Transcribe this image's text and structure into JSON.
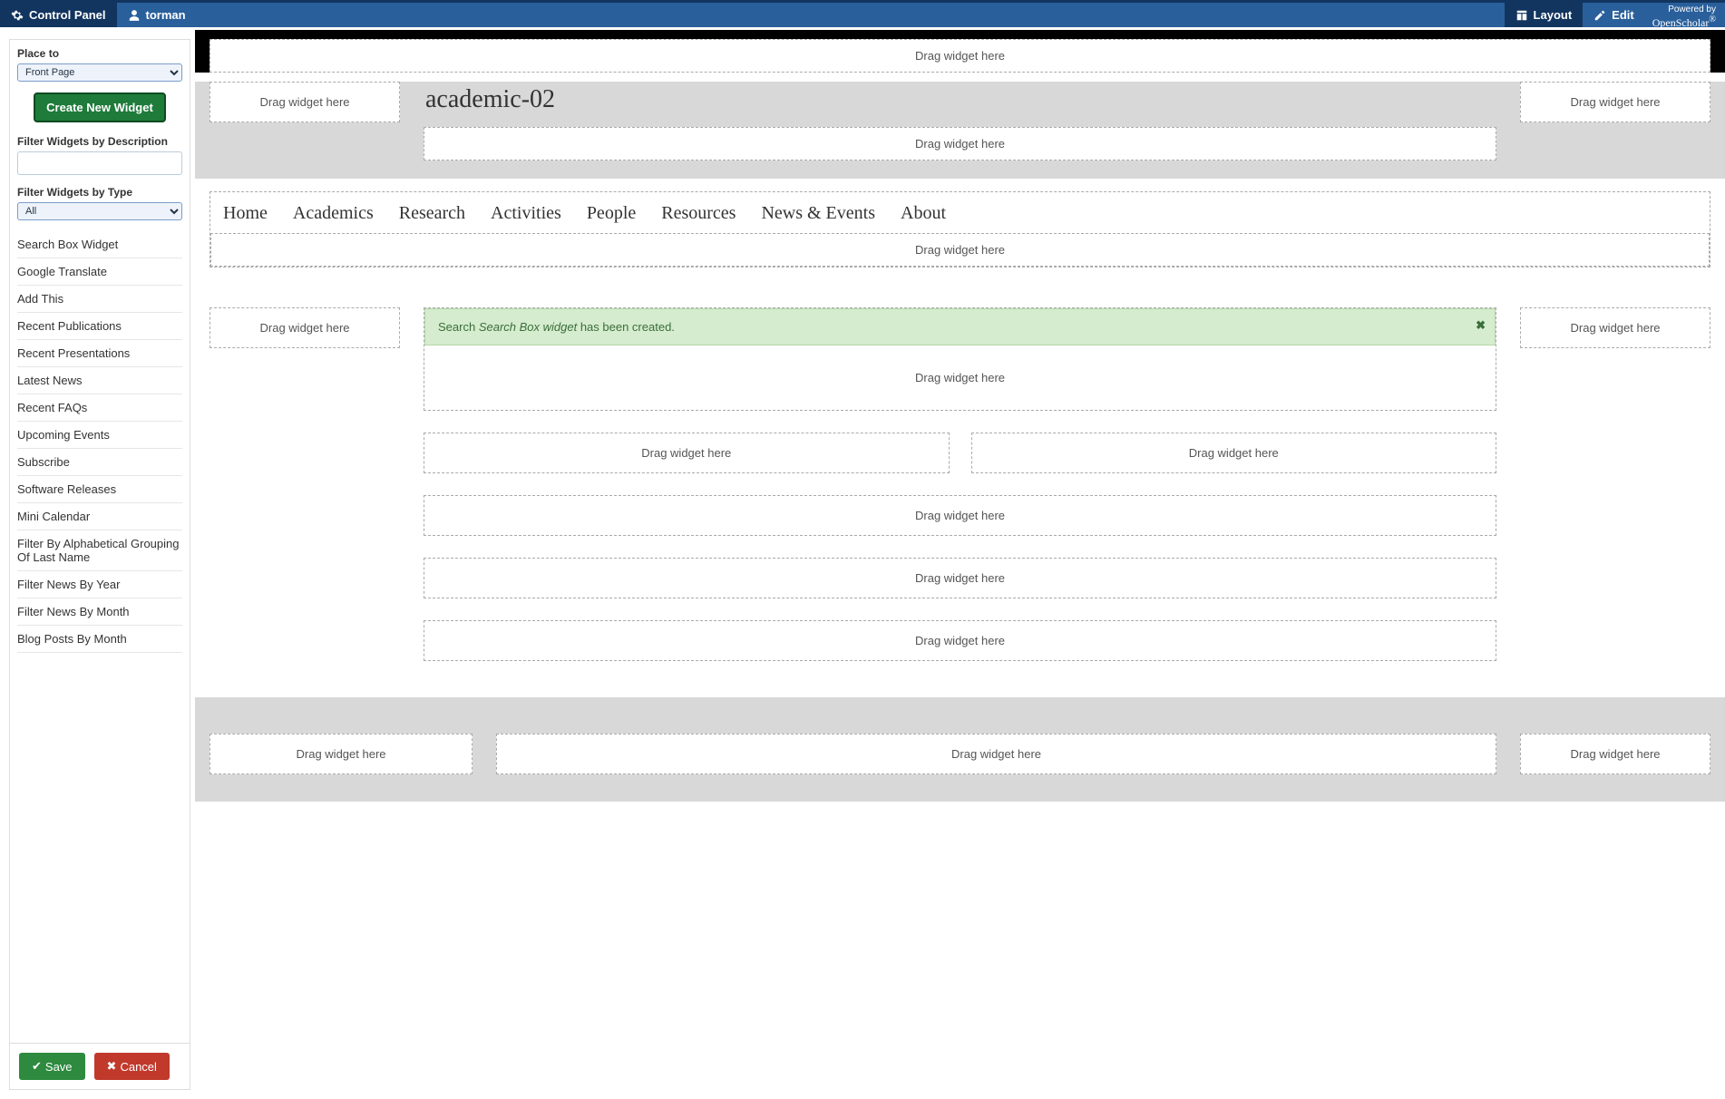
{
  "adminbar": {
    "control_panel": "Control Panel",
    "username": "torman",
    "layout": "Layout",
    "edit": "Edit",
    "powered_by": "Powered by",
    "openscholar": "OpenScholar"
  },
  "sidebar": {
    "place_to_label": "Place to",
    "place_to_value": "Front Page",
    "create_button": "Create New Widget",
    "filter_desc_label": "Filter Widgets by Description",
    "filter_desc_value": "",
    "filter_type_label": "Filter Widgets by Type",
    "filter_type_value": "All",
    "widgets": [
      "Search Box Widget",
      "Google Translate",
      "Add This",
      "Recent Publications",
      "Recent Presentations",
      "Latest News",
      "Recent FAQs",
      "Upcoming Events",
      "Subscribe",
      "Software Releases",
      "Mini Calendar",
      "Filter By Alphabetical Grouping Of Last Name",
      "Filter News By Year",
      "Filter News By Month",
      "Blog Posts By Month"
    ],
    "save": "Save",
    "cancel": "Cancel"
  },
  "canvas": {
    "drag_text": "Drag widget here",
    "site_title": "academic-02",
    "nav": [
      "Home",
      "Academics",
      "Research",
      "Activities",
      "People",
      "Resources",
      "News & Events",
      "About"
    ],
    "alert_prefix": "Search ",
    "alert_em": "Search Box widget",
    "alert_suffix": " has been created."
  }
}
